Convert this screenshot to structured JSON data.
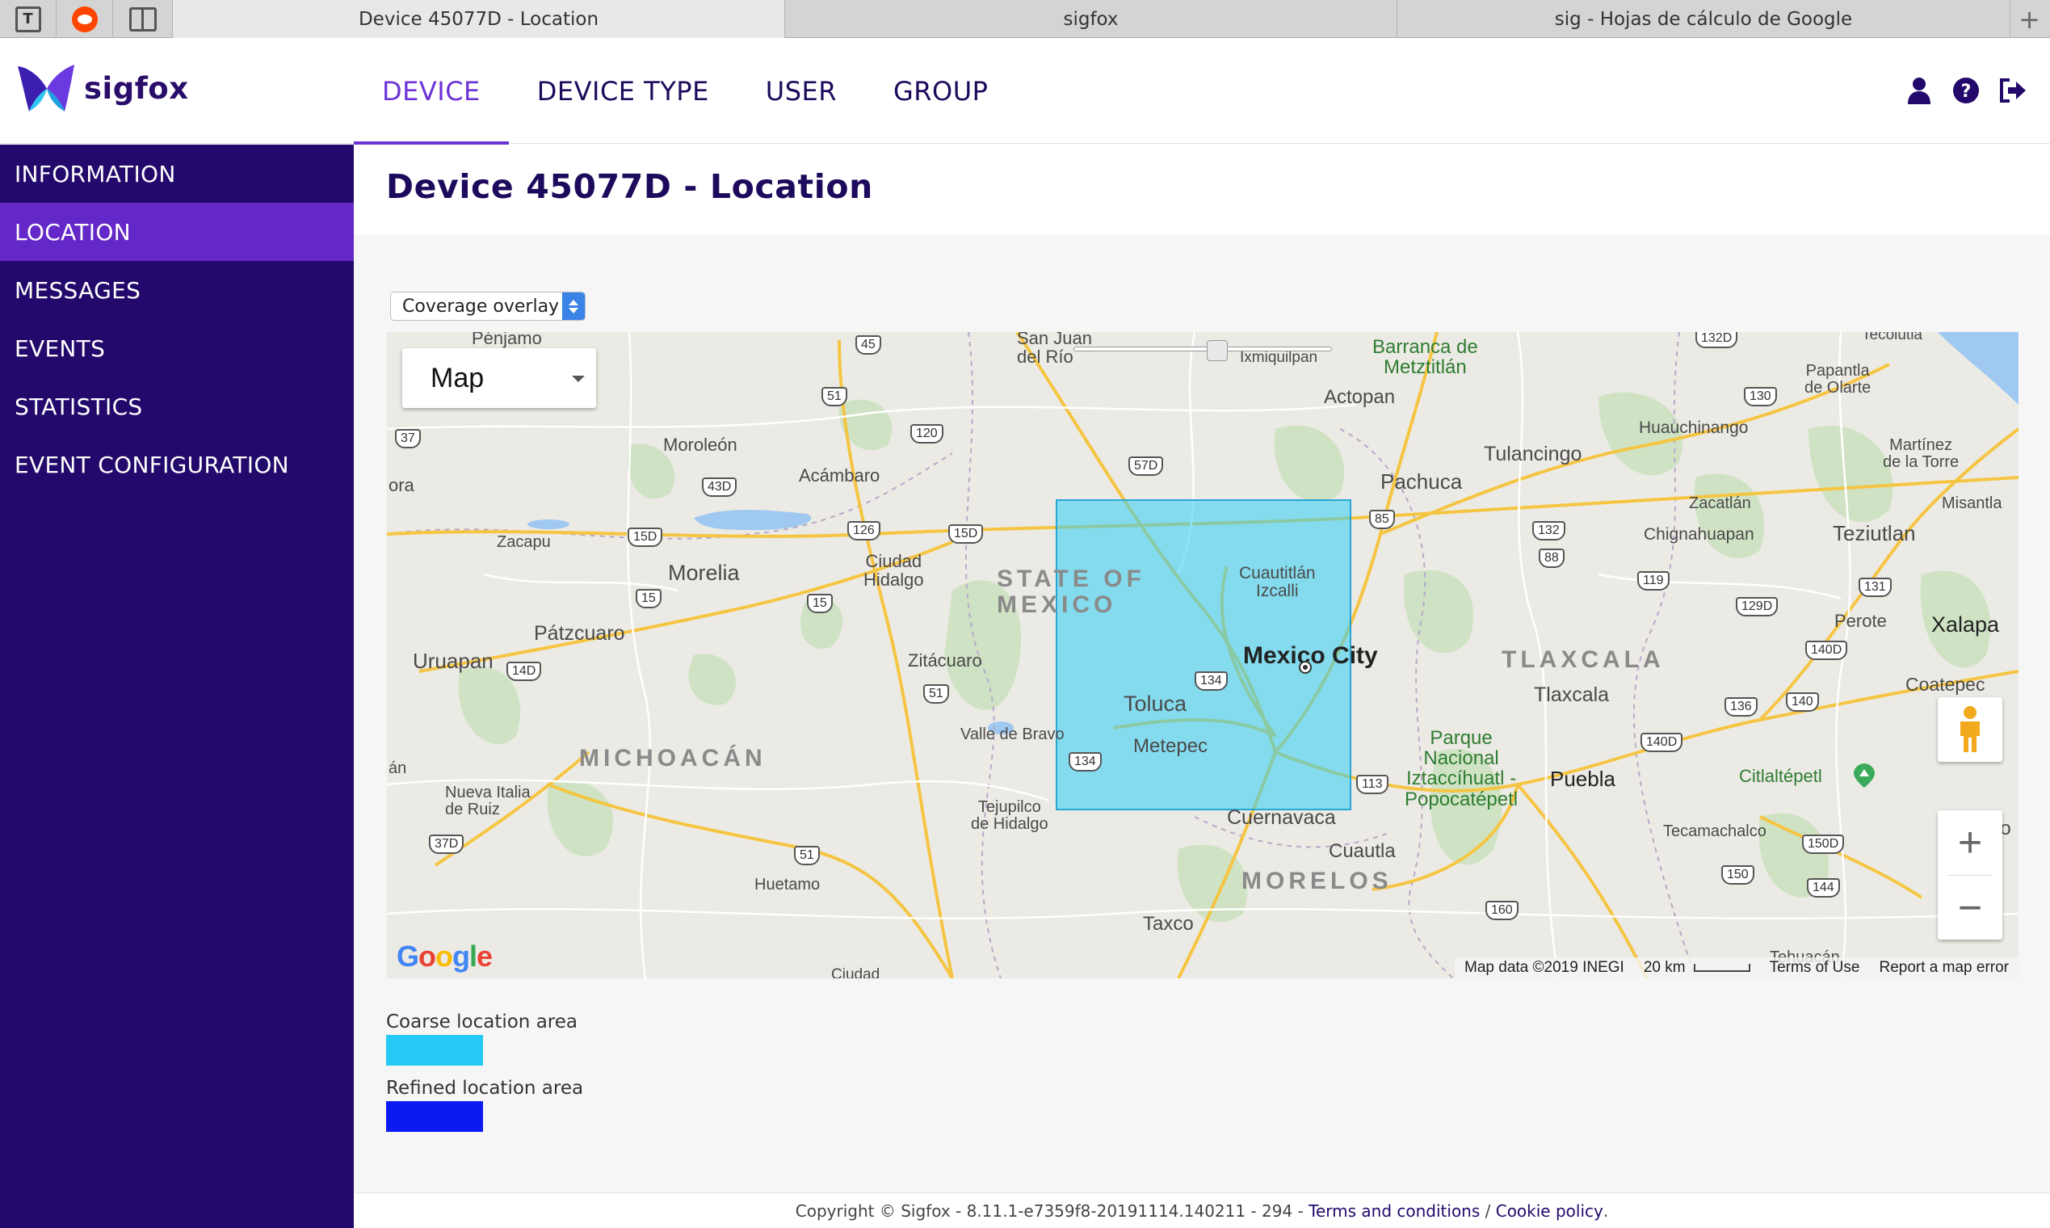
{
  "browser": {
    "tabs": [
      {
        "title": "Device 45077D - Location",
        "active": true
      },
      {
        "title": "sigfox",
        "active": false
      },
      {
        "title": "sig - Hojas de cálculo de Google",
        "active": false
      }
    ],
    "new_tab_symbol": "+"
  },
  "header": {
    "logo_text": "sigfox",
    "nav": [
      {
        "label": "DEVICE",
        "active": true
      },
      {
        "label": "DEVICE TYPE",
        "active": false
      },
      {
        "label": "USER",
        "active": false
      },
      {
        "label": "GROUP",
        "active": false
      }
    ],
    "icons": [
      "user-icon",
      "help-icon",
      "logout-icon"
    ]
  },
  "sidebar": {
    "items": [
      {
        "label": "INFORMATION",
        "active": false
      },
      {
        "label": "LOCATION",
        "active": true
      },
      {
        "label": "MESSAGES",
        "active": false
      },
      {
        "label": "EVENTS",
        "active": false
      },
      {
        "label": "STATISTICS",
        "active": false
      },
      {
        "label": "EVENT CONFIGURATION",
        "active": false
      }
    ]
  },
  "page": {
    "title": "Device 45077D - Location",
    "overlay_select": {
      "value": "Coverage overlay"
    }
  },
  "map": {
    "type_control": "Map",
    "places": {
      "penjamo": "Pénjamo",
      "san_juan": "San Juan\ndel Río",
      "ixmiquilpan": "Ixmiquilpan",
      "barranca": "Barranca de\nMetztitlán",
      "tecolutla": "Tecolutla",
      "papantla": "Papantla\nde Olarte",
      "moroleon": "Moroleón",
      "acambaro": "Acámbaro",
      "actopan": "Actopan",
      "huauchinango": "Huauchinango",
      "martinez": "Martínez\nde la Torre",
      "tulancingo": "Tulancingo",
      "pachuca": "Pachuca",
      "misantla": "Misantla",
      "zacatlan": "Zacatlán",
      "chignahuapan": "Chignahuapan",
      "teziutlan": "Teziutlan",
      "zacapu": "Zacapu",
      "morelia": "Morelia",
      "ciudad_hidalgo": "Ciudad\nHidalgo",
      "state_of_mexico": "STATE OF\nMEXICO",
      "cuautitlan": "Cuautitlán\nIzcalli",
      "perote": "Perote",
      "xalapa": "Xalapa",
      "patzcuaro": "Pátzcuaro",
      "uruapan": "Uruapan",
      "zitacuaro": "Zitácuaro",
      "mexico_city": "Mexico City",
      "tlaxcala_region": "TLAXCALA",
      "tlaxcala": "Tlaxcala",
      "coatepec": "Coatepec",
      "toluca": "Toluca",
      "valle_bravo": "Valle de Bravo",
      "metepec": "Metepec",
      "michoacan": "MICHOACÁN",
      "parque": "Parque\nNacional\nIztaccíhuatl -\nPopocatépetl",
      "puebla": "Puebla",
      "citlaltepetl": "Citlaltépetl",
      "nueva_italia": "Nueva Italia\nde Ruiz",
      "tejupilco": "Tejupilco\nde Hidalgo",
      "cuernavaca": "Cuernavaca",
      "tecamachalco": "Tecamachalco",
      "cuautla": "Cuautla",
      "huetamo": "Huetamo",
      "morelos": "MORELOS",
      "taxco": "Taxco",
      "ora": "ora",
      "an": "án",
      "co": "Co",
      "tehuacan": "Tehuacán",
      "ciudad_bottom": "Ciudad"
    },
    "highways": [
      "45",
      "51",
      "120",
      "37",
      "43D",
      "57D",
      "15D",
      "126",
      "15D",
      "85",
      "130",
      "132",
      "88",
      "15",
      "15",
      "119",
      "131",
      "129D",
      "14D",
      "134",
      "51",
      "140D",
      "136",
      "140",
      "134",
      "113",
      "140D",
      "37D",
      "51",
      "150D",
      "150",
      "144",
      "160",
      "132D"
    ],
    "attribution": {
      "map_data": "Map data ©2019 INEGI",
      "scale": "20 km",
      "terms": "Terms of Use",
      "report": "Report a map error"
    },
    "google_logo": "Google",
    "zoom_in": "+",
    "zoom_out": "−"
  },
  "legend": {
    "coarse": {
      "label": "Coarse location area",
      "color": "#26c9f5"
    },
    "refined": {
      "label": "Refined location area",
      "color": "#0b1af2"
    }
  },
  "footer": {
    "text": "Copyright © Sigfox - 8.11.1-e7359f8-20191114.140211 - 294 - ",
    "terms": "Terms and conditions",
    "separator": " / ",
    "cookie": "Cookie policy",
    "end": "."
  },
  "colors": {
    "brand_dark": "#22096b",
    "brand_accent": "#6c33d6",
    "sidebar_active": "#6428c8",
    "coverage_overlay": "#30cdf5"
  }
}
